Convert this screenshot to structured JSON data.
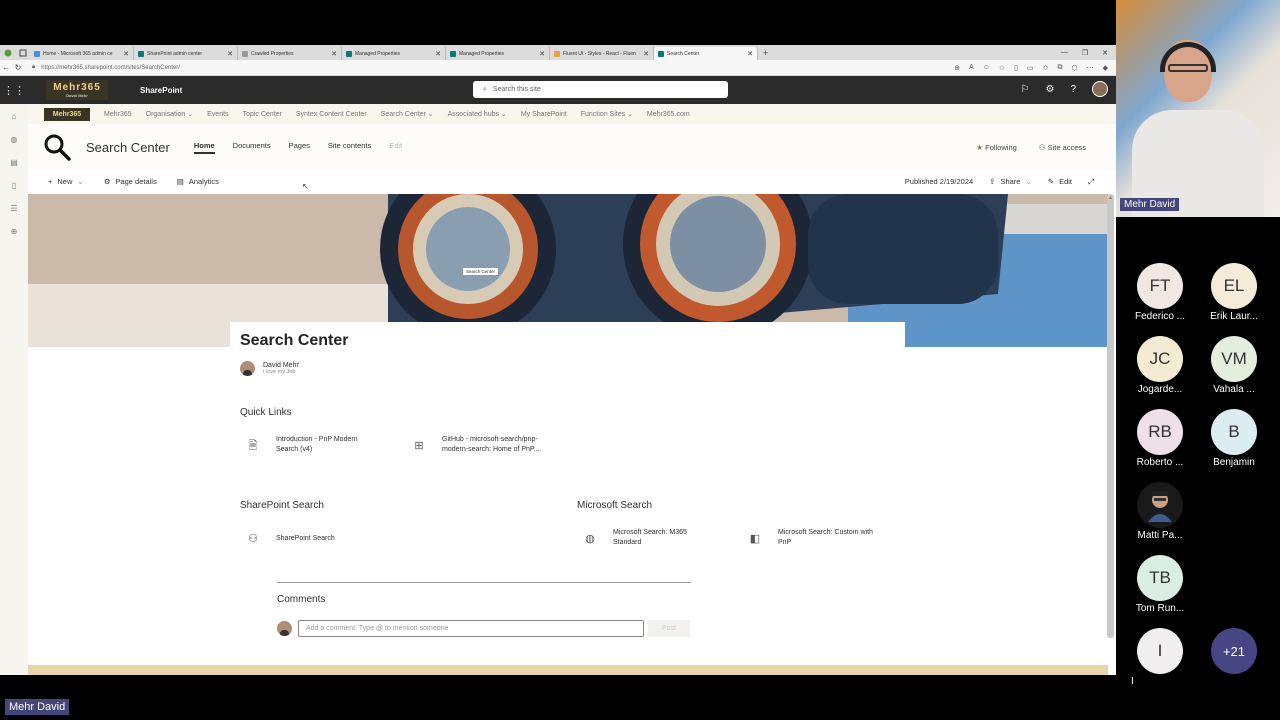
{
  "browser": {
    "tabs": [
      {
        "title": "Home - Microsoft 365 admin ce",
        "color": "#4a90d9"
      },
      {
        "title": "SharePoint admin center",
        "color": "#0b7a75"
      },
      {
        "title": "Crawled Properties",
        "color": "#999999"
      },
      {
        "title": "Managed Properties",
        "color": "#0b7a75"
      },
      {
        "title": "Managed Properties",
        "color": "#0b7a75"
      },
      {
        "title": "Fluent UI - Styles - React - Fluen",
        "color": "#e8a33b"
      },
      {
        "title": "Search Center",
        "color": "#0b7a75"
      }
    ],
    "url": "https://mehr365.sharepoint.com/sites/SearchCenter/"
  },
  "suite": {
    "brand": "Mehr365",
    "brand_sub": "David Mehr",
    "app": "SharePoint",
    "search_placeholder": "Search this site"
  },
  "hub": {
    "logo": "Mehr365",
    "items": [
      "Mehr365",
      "Organisation ⌄",
      "Events",
      "Topic Center",
      "Syntex Content Center",
      "Search Center ⌄",
      "Associated hubs ⌄",
      "My SharePoint",
      "Function Sites ⌄",
      "Mehr365.com"
    ]
  },
  "site": {
    "title": "Search Center",
    "nav": [
      "Home",
      "Documents",
      "Pages",
      "Site contents",
      "Edit"
    ],
    "following": "Following",
    "site_access": "Site access"
  },
  "commands": {
    "new": "New",
    "page_details": "Page details",
    "analytics": "Analytics",
    "published": "Published 2/19/2024",
    "share": "Share",
    "edit": "Edit"
  },
  "hero": {
    "tooltip": "Search Center"
  },
  "page": {
    "title": "Search Center",
    "author": "David Mehr",
    "author_sub": "I love my Job"
  },
  "quick_links": {
    "heading": "Quick Links",
    "items": [
      {
        "line1": "Introduction - PnP Modern",
        "line2": "Search (v4)"
      },
      {
        "line1": "GitHub - microsoft-search/pnp-",
        "line2": "modern-search: Home of PnP..."
      }
    ]
  },
  "sharepoint_search": {
    "heading": "SharePoint Search",
    "items": [
      {
        "line1": "SharePoint Search"
      }
    ]
  },
  "microsoft_search": {
    "heading": "Microsoft Search",
    "items": [
      {
        "line1": "Microsoft Search: M365",
        "line2": "Standard"
      },
      {
        "line1": "Microsoft Search: Custom with",
        "line2": "PnP"
      }
    ]
  },
  "comments": {
    "heading": "Comments",
    "placeholder": "Add a comment. Type @ to mention someone",
    "post": "Post"
  },
  "meeting": {
    "speaker": "Mehr David",
    "bottom_name": "Mehr David",
    "participants": [
      {
        "initials": "FT",
        "name": "Federico ...",
        "color": "#f1e7e3"
      },
      {
        "initials": "EL",
        "name": "Erik Laur...",
        "color": "#f6ead8"
      },
      {
        "initials": "JC",
        "name": "Jogarde...",
        "color": "#f4ecd2"
      },
      {
        "initials": "VM",
        "name": "Vahala ...",
        "color": "#e3efdc"
      },
      {
        "initials": "RB",
        "name": "Roberto ...",
        "color": "#efdfe9"
      },
      {
        "initials": "B",
        "name": "Benjamin",
        "color": "#dcedf1"
      },
      {
        "initials": "",
        "name": "Matti Pa...",
        "color": "#1a1a1a"
      },
      {
        "initials": "TB",
        "name": "Tom Run...",
        "color": "#d9efe3"
      },
      {
        "initials": "I",
        "name": "I",
        "color": "#f0eeee"
      },
      {
        "initials": "+21",
        "name": "",
        "color": "#464685"
      }
    ]
  }
}
